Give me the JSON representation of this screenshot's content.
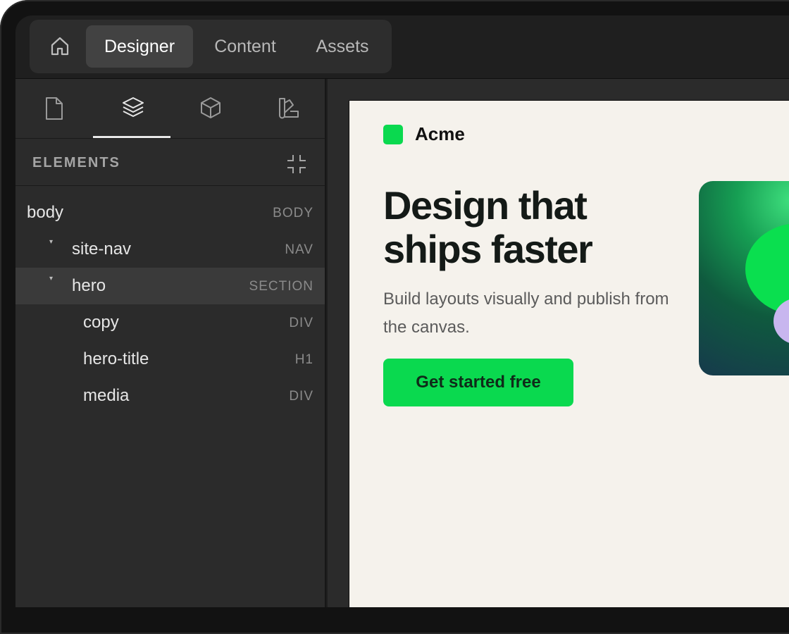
{
  "topbar": {
    "home_icon": "home-icon",
    "tabs": [
      {
        "label": "Designer",
        "active": true
      },
      {
        "label": "Content",
        "active": false
      },
      {
        "label": "Assets",
        "active": false
      }
    ]
  },
  "sidebar": {
    "panel_tabs": [
      {
        "icon": "page-icon",
        "active": false
      },
      {
        "icon": "layers-icon",
        "active": true
      },
      {
        "icon": "cube-icon",
        "active": false
      },
      {
        "icon": "swatch-icon",
        "active": false
      }
    ],
    "elements_title": "ELEMENTS",
    "collapse_icon": "collapse-icon",
    "tree": [
      {
        "name": "body",
        "tag": "BODY",
        "depth": 0,
        "caret": false,
        "selected": false
      },
      {
        "name": "site-nav",
        "tag": "NAV",
        "depth": 1,
        "caret": true,
        "selected": false
      },
      {
        "name": "hero",
        "tag": "SECTION",
        "depth": 1,
        "caret": true,
        "selected": true
      },
      {
        "name": "copy",
        "tag": "DIV",
        "depth": 2,
        "caret": false,
        "selected": false
      },
      {
        "name": "hero-title",
        "tag": "H1",
        "depth": 2,
        "caret": false,
        "selected": false
      },
      {
        "name": "media",
        "tag": "DIV",
        "depth": 2,
        "caret": false,
        "selected": false
      }
    ]
  },
  "canvas": {
    "brand_name": "Acme",
    "hero_title": "Design that ships faster",
    "hero_subtitle": "Build layouts visually and publish from the canvas.",
    "cta_label": "Get started free"
  },
  "colors": {
    "accent": "#0ad94f",
    "canvas_bg": "#f5f2ec",
    "editor_bg": "#2b2b2b",
    "media_purple": "#c8b6ef"
  }
}
